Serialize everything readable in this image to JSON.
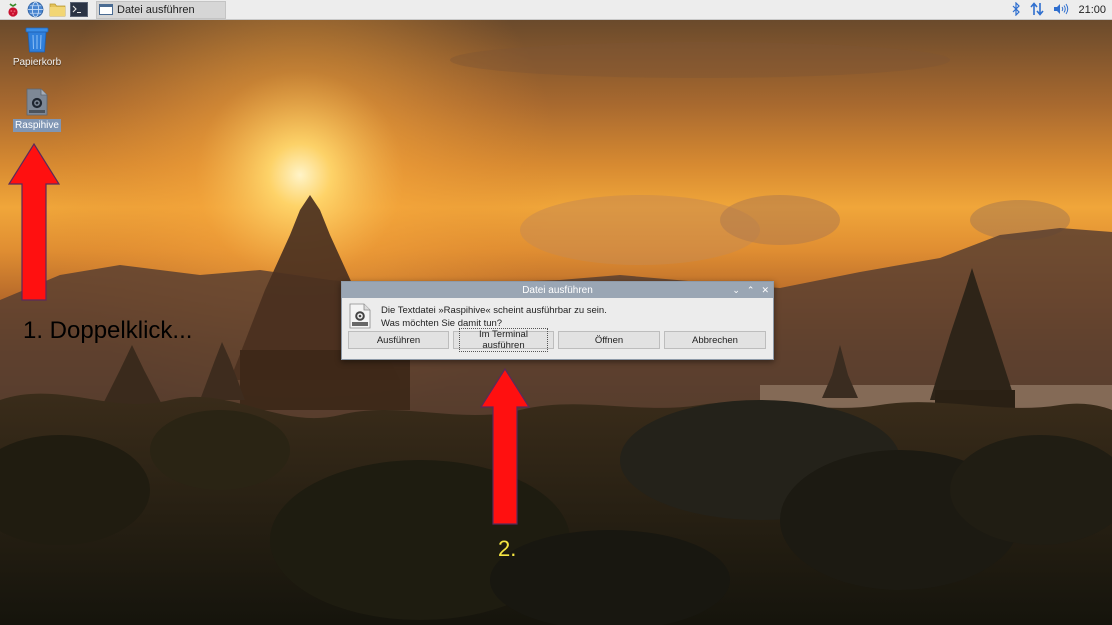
{
  "taskbar": {
    "task_title": "Datei ausführen",
    "clock": "21:00",
    "launcher_icons": [
      "raspberry-menu-icon",
      "web-browser-icon",
      "file-manager-icon",
      "terminal-icon"
    ],
    "tray_icons": [
      "bluetooth-icon",
      "network-icon",
      "volume-icon"
    ]
  },
  "desktop": {
    "trash_label": "Papierkorb",
    "file_label": "Raspihive"
  },
  "dialog": {
    "title": "Datei ausführen",
    "message_line1": "Die Textdatei »Raspihive« scheint ausführbar zu sein.",
    "message_line2": "Was möchten Sie damit tun?",
    "buttons": {
      "execute": "Ausführen",
      "execute_terminal": "Im Terminal ausführen",
      "open": "Öffnen",
      "cancel": "Abbrechen"
    },
    "controls": {
      "minimize": "⌄",
      "maximize": "⌃",
      "close": "✕"
    }
  },
  "annotations": {
    "step1": "1. Doppelklick...",
    "step2": "2.",
    "arrow_color": "#ff1a1a",
    "step2_color": "#f5e642"
  },
  "colors": {
    "taskbar_bg": "#ededed",
    "dialog_title_bg": "#9aa6b4",
    "selection_bg": "#8096b4"
  }
}
